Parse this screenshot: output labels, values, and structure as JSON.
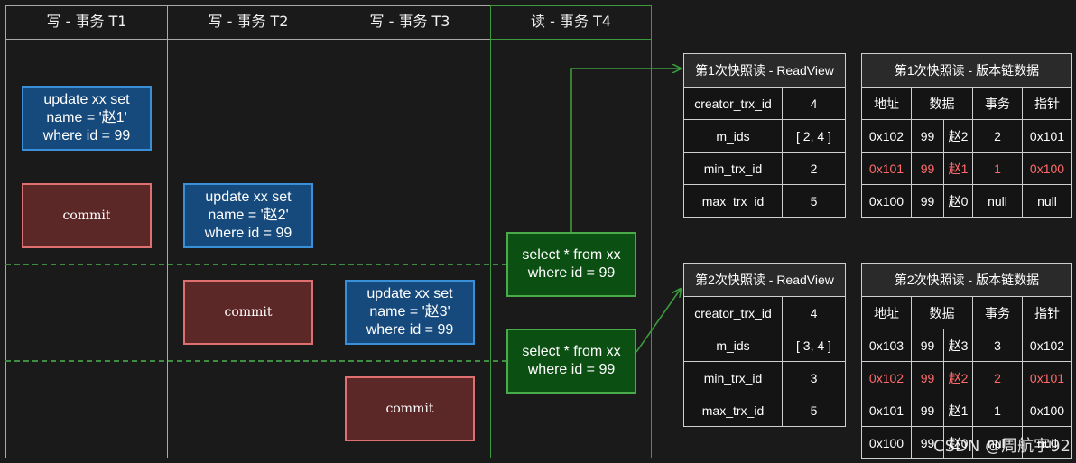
{
  "columns": [
    {
      "title": "写 - 事务 T1"
    },
    {
      "title": "写 - 事务 T2"
    },
    {
      "title": "写 - 事务 T3"
    },
    {
      "title": "读 - 事务 T4"
    }
  ],
  "t1": {
    "update": [
      "update xx set",
      "name =  '赵1'",
      "where id = 99"
    ],
    "commit": "commit"
  },
  "t2": {
    "update": [
      "update xx set",
      "name =  '赵2'",
      "where id = 99"
    ],
    "commit": "commit"
  },
  "t3": {
    "update": [
      "update xx set",
      "name =  '赵3'",
      "where id = 99"
    ],
    "commit": "commit"
  },
  "t4": {
    "select1": [
      "select * from xx",
      "where id = 99"
    ],
    "select2": [
      "select * from xx",
      "where id = 99"
    ]
  },
  "readview1": {
    "title": "第1次快照读 - ReadView",
    "rows": [
      {
        "key": "creator_trx_id",
        "value": "4"
      },
      {
        "key": "m_ids",
        "value": "[ 2, 4 ]"
      },
      {
        "key": "min_trx_id",
        "value": "2"
      },
      {
        "key": "max_trx_id",
        "value": "5"
      }
    ]
  },
  "readview2": {
    "title": "第2次快照读 - ReadView",
    "rows": [
      {
        "key": "creator_trx_id",
        "value": "4"
      },
      {
        "key": "m_ids",
        "value": "[ 3, 4 ]"
      },
      {
        "key": "min_trx_id",
        "value": "3"
      },
      {
        "key": "max_trx_id",
        "value": "5"
      }
    ]
  },
  "chain1": {
    "title": "第1次快照读 - 版本链数据",
    "headers": [
      "地址",
      "数据",
      "事务",
      "指针"
    ],
    "rows": [
      {
        "addr": "0x102",
        "id": "99",
        "name": "赵2",
        "trx": "2",
        "ptr": "0x101"
      },
      {
        "addr": "0x101",
        "id": "99",
        "name": "赵1",
        "trx": "1",
        "ptr": "0x100"
      },
      {
        "addr": "0x100",
        "id": "99",
        "name": "赵0",
        "trx": "null",
        "ptr": "null"
      }
    ]
  },
  "chain2": {
    "title": "第2次快照读 - 版本链数据",
    "headers": [
      "地址",
      "数据",
      "事务",
      "指针"
    ],
    "rows": [
      {
        "addr": "0x103",
        "id": "99",
        "name": "赵3",
        "trx": "3",
        "ptr": "0x102"
      },
      {
        "addr": "0x102",
        "id": "99",
        "name": "赵2",
        "trx": "2",
        "ptr": "0x101"
      },
      {
        "addr": "0x101",
        "id": "99",
        "name": "赵1",
        "trx": "1",
        "ptr": "0x100"
      },
      {
        "addr": "0x100",
        "id": "99",
        "name": "赵0",
        "trx": "null",
        "ptr": "null"
      }
    ]
  },
  "watermark": "CSDN @周航宇92",
  "colors": {
    "highlight": "#ff6b6b",
    "green": "#3c9a3c",
    "blue": "#3a8fd9",
    "red": "#e06f6f"
  }
}
